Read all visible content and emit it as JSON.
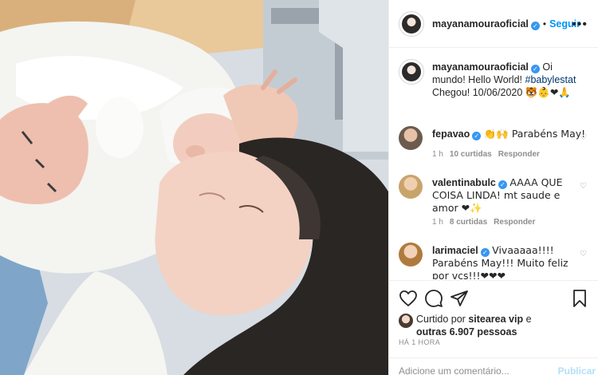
{
  "post": {
    "image_alt": "Mother lying beside newborn baby in hospital bed"
  },
  "header": {
    "username": "mayanamouraoficial",
    "separator": "•",
    "follow_label": "Seguir",
    "more_icon": "more-options-icon"
  },
  "caption": {
    "username": "mayanamouraoficial",
    "text_pre": "Oi mundo! Hello World! ",
    "hashtag": "#babylestat",
    "text_post": " Chegou! 10/06/2020 ",
    "emojis": "🐯👶❤🙏"
  },
  "comments": [
    {
      "username": "fepavao",
      "text": "👏🙌 Parabéns May!",
      "time": "1 h",
      "likes": "10 curtidas",
      "reply": "Responder"
    },
    {
      "username": "valentinabulc",
      "text": "AAAA QUE COISA LINDA! mt saude e amor ❤✨",
      "time": "1 h",
      "likes": "8 curtidas",
      "reply": "Responder"
    },
    {
      "username": "larimaciel",
      "text": "Vivaaaaa!!!! Parabéns May!!! Muito feliz por vcs!!!❤❤❤",
      "time": "",
      "likes": "",
      "reply": ""
    }
  ],
  "actions": {
    "like_icon": "heart-icon",
    "comment_icon": "comment-icon",
    "share_icon": "share-icon",
    "save_icon": "bookmark-icon"
  },
  "likes": {
    "prefix": "Curtido por ",
    "user": "sitearea vip",
    "middle": " e ",
    "others": "outras 6.907 pessoas"
  },
  "timestamp": "HÁ 1 HORA",
  "add_comment": {
    "placeholder": "Adicione um comentário...",
    "publish_label": "Publicar"
  },
  "colors": {
    "accent": "#0095f6",
    "verified": "#3897f0",
    "muted": "#8e8e8e",
    "hashtag": "#00376b"
  }
}
